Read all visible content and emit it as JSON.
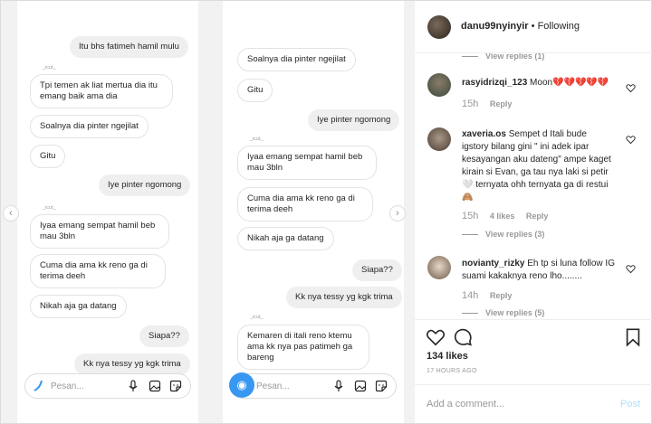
{
  "header": {
    "username": "danu99nyinyir",
    "separator": "•",
    "follow_status": "Following"
  },
  "chat_left": {
    "messages": [
      {
        "text": "Itu bhs fatimeh hamil mulu",
        "dir": "out"
      },
      {
        "sender": "_icut_"
      },
      {
        "text": "Tpi temen ak liat mertua dia itu emang baik ama dia",
        "dir": "in"
      },
      {
        "text": "Soalnya dia pinter ngejilat",
        "dir": "in"
      },
      {
        "text": "Gitu",
        "dir": "in"
      },
      {
        "text": "Iye pinter ngomong",
        "dir": "out"
      },
      {
        "sender": "_icut_"
      },
      {
        "text": "Iyaa emang sempat hamil beb mau 3bln",
        "dir": "in"
      },
      {
        "text": "Cuma dia ama kk reno ga di terima deeh",
        "dir": "in"
      },
      {
        "text": "Nikah aja ga datang",
        "dir": "in"
      },
      {
        "text": "Siapa??",
        "dir": "out"
      },
      {
        "text": "Kk nya tessy yg kgk trima",
        "dir": "out"
      }
    ],
    "input_placeholder": "Pesan..."
  },
  "chat_right": {
    "messages": [
      {
        "text": "Soalnya dia pinter ngejilat",
        "dir": "in"
      },
      {
        "text": "Gitu",
        "dir": "in"
      },
      {
        "text": "Iye pinter ngomong",
        "dir": "out"
      },
      {
        "sender": "_icut_"
      },
      {
        "text": "Iyaa emang sempat hamil beb mau 3bln",
        "dir": "in"
      },
      {
        "text": "Cuma dia ama kk reno ga di terima deeh",
        "dir": "in"
      },
      {
        "text": "Nikah aja ga datang",
        "dir": "in"
      },
      {
        "text": "Siapa??",
        "dir": "out"
      },
      {
        "text": "Kk nya tessy yg kgk trima",
        "dir": "out"
      },
      {
        "sender": "_icut_"
      },
      {
        "text": "Kemaren di itali reno ktemu ama kk nya pas patimeh ga bareng",
        "dir": "in"
      }
    ],
    "input_placeholder": "Pesan..."
  },
  "comments": {
    "top_replies": "View replies (1)",
    "items": [
      {
        "username": "rasyidrizqi_123",
        "text": "Moon💔💔💔💔💔",
        "time": "15h",
        "reply": "Reply"
      },
      {
        "username": "xaveria.os",
        "text": "Sempet d Itali bude igstory bilang gini \" ini adek ipar kesayangan aku dateng\" ampe kaget kirain si Evan, ga tau nya laki si petir 🤍 ternyata ohh ternyata ga di restui 🙈",
        "time": "15h",
        "likes": "4 likes",
        "reply": "Reply",
        "replies": "View replies (3)"
      },
      {
        "username": "novianty_rizky",
        "text": "Eh tp si luna follow IG suami kakaknya reno lho........",
        "time": "14h",
        "reply": "Reply",
        "replies": "View replies (5)"
      }
    ]
  },
  "post": {
    "likes": "134 likes",
    "time_ago": "17 HOURS AGO",
    "add_comment_placeholder": "Add a comment...",
    "post_label": "Post"
  },
  "colors": {
    "accent": "#3897f0",
    "post_disabled": "#b2dffc"
  }
}
